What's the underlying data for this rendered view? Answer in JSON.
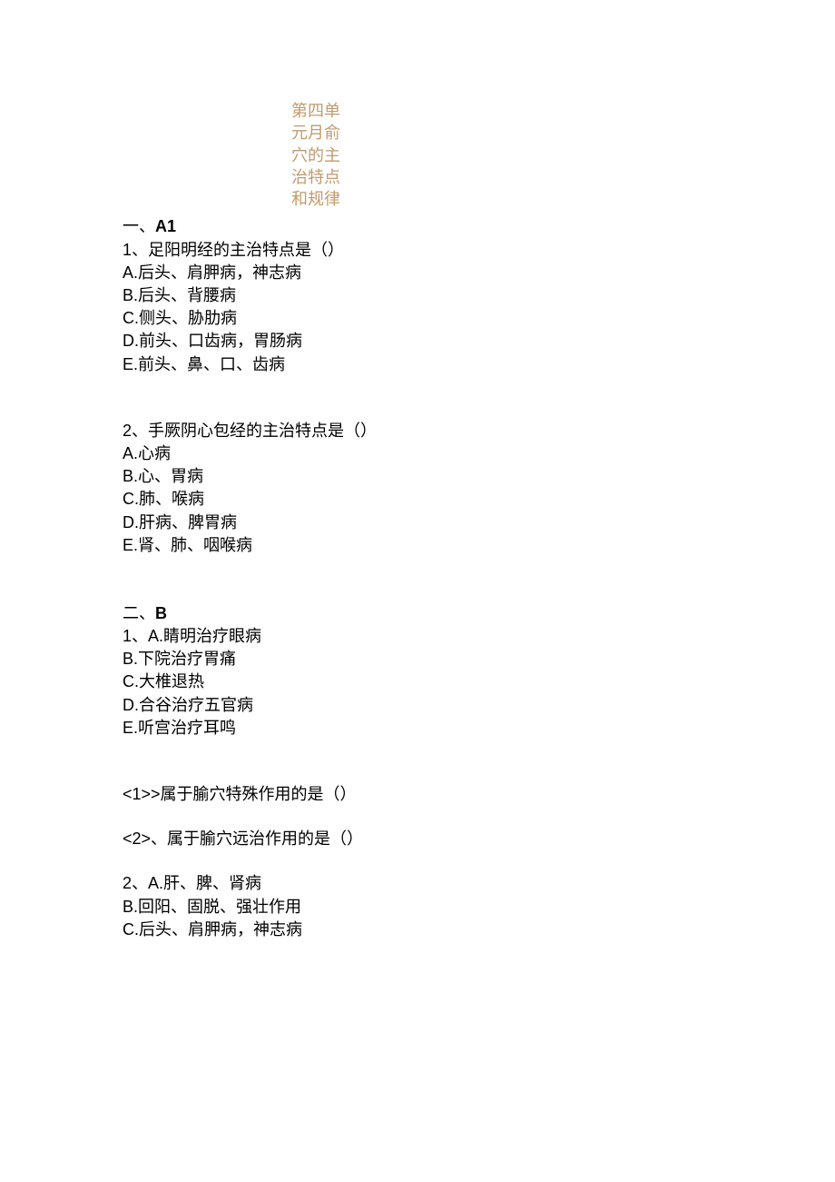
{
  "title": {
    "l1": "第四单",
    "l2": "元月俞",
    "l3": "穴的主",
    "l4": "治特点",
    "l5": "和规律"
  },
  "sectionA": {
    "heading_han": "一、",
    "heading_latin": "A1",
    "q1": {
      "num": "1",
      "sep": "、",
      "stem": "足阳明经的主治特点是（）",
      "A": {
        "letter": "A.",
        "text": "后头、肩胛病，神志病"
      },
      "B": {
        "letter": "B.",
        "text": "后头、背腰病"
      },
      "C": {
        "letter": "C.",
        "text": "侧头、胁肋病"
      },
      "D": {
        "letter": "D.",
        "text": "前头、口齿病，胃肠病"
      },
      "E": {
        "letter": "E.",
        "text": "前头、鼻、口、齿病"
      }
    },
    "q2": {
      "num": "2",
      "sep": "、",
      "stem": "手厥阴心包经的主治特点是（）",
      "A": {
        "letter": "A.",
        "text": "心病"
      },
      "B": {
        "letter": "B.",
        "text": "心、胃病"
      },
      "C": {
        "letter": "C.",
        "text": "肺、喉病"
      },
      "D": {
        "letter": "D.",
        "text": "肝病、脾胃病"
      },
      "E": {
        "letter": "E.",
        "text": "肾、肺、咽喉病"
      }
    }
  },
  "sectionB": {
    "heading_han": "二、",
    "heading_latin": "B",
    "q1": {
      "num": "1",
      "sep": "、",
      "A": {
        "letter": "A.",
        "text": "睛明治疗眼病"
      },
      "B": {
        "letter": "B.",
        "text": "下院治疗胃痛"
      },
      "C": {
        "letter": "C.",
        "text": "大椎退热"
      },
      "D": {
        "letter": "D.",
        "text": "合谷治疗五官病"
      },
      "E": {
        "letter": "E.",
        "text": "听宫治疗耳鸣"
      },
      "sub1": {
        "prefix": "<1>>",
        "text": "属于腧穴特殊作用的是（）"
      },
      "sub2": {
        "prefix": "<2>",
        "sep": "、",
        "text": "属于腧穴远治作用的是（）"
      }
    },
    "q2": {
      "num": "2",
      "sep": "、",
      "A": {
        "letter": "A.",
        "text": "肝、脾、肾病"
      },
      "B": {
        "letter": "B.",
        "text": "回阳、固脱、强壮作用"
      },
      "C": {
        "letter": "C.",
        "text": "后头、肩胛病，神志病"
      }
    }
  }
}
